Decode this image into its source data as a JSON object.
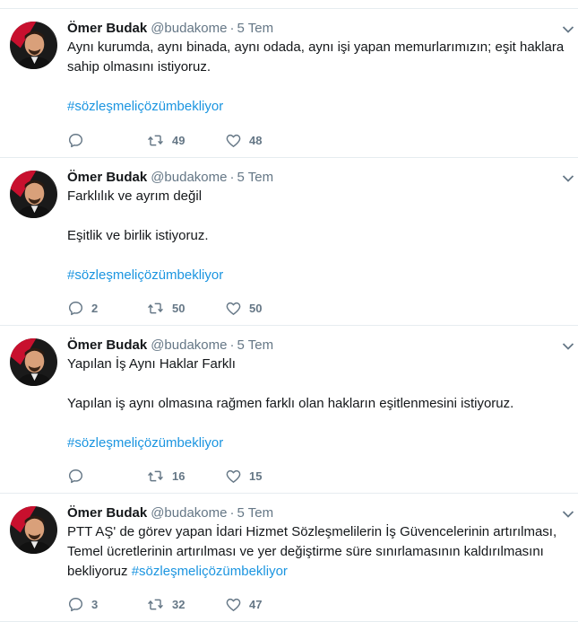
{
  "tweets": [
    {
      "name": "Ömer Budak",
      "handle": "@budakome",
      "dot": "·",
      "time": "5 Tem",
      "line1": "Aynı kurumda, aynı binada, aynı odada, aynı işi yapan memurlarımızın; eşit haklara",
      "line2": "sahip olmasını istiyoruz.",
      "hashtag": "#sözleşmeliçözümbekliyor",
      "replies": "",
      "retweets": "49",
      "likes": "48"
    },
    {
      "name": "Ömer Budak",
      "handle": "@budakome",
      "dot": "·",
      "time": "5 Tem",
      "line1": "Farklılık ve ayrım değil",
      "line2": "Eşitlik ve birlik istiyoruz.",
      "hashtag": "#sözleşmeliçözümbekliyor",
      "replies": "2",
      "retweets": "50",
      "likes": "50"
    },
    {
      "name": "Ömer Budak",
      "handle": "@budakome",
      "dot": "·",
      "time": "5 Tem",
      "line1": "Yapılan İş Aynı Haklar Farklı",
      "line2": "Yapılan iş aynı olmasına rağmen farklı olan hakların eşitlenmesini istiyoruz.",
      "hashtag": "#sözleşmeliçözümbekliyor",
      "replies": "",
      "retweets": "16",
      "likes": "15"
    },
    {
      "name": "Ömer Budak",
      "handle": "@budakome",
      "dot": "·",
      "time": "5 Tem",
      "line1": "PTT AŞ' de görev yapan İdari Hizmet Sözleşmelilerin İş Güvencelerinin artırılması,",
      "line2": "Temel ücretlerinin artırılması ve yer değiştirme süre sınırlamasının kaldırılmasını",
      "line3": "bekliyoruz",
      "hashtag": "#sözleşmeliçözümbekliyor",
      "replies": "3",
      "retweets": "32",
      "likes": "47"
    }
  ],
  "icons": {
    "reply": "reply-icon",
    "retweet": "retweet-icon",
    "like": "heart-icon",
    "more": "chevron-down-icon"
  },
  "colors": {
    "text": "#14171a",
    "secondary": "#657786",
    "link": "#1b95e0",
    "border": "#e6ecf0"
  }
}
